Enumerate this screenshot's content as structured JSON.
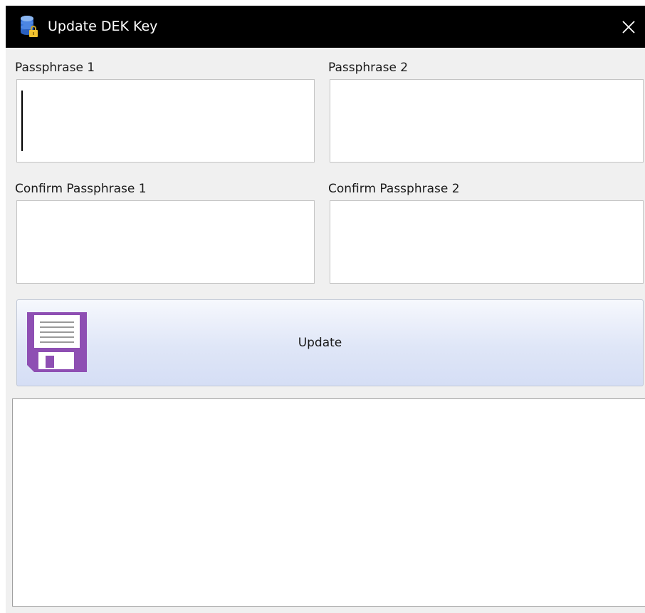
{
  "window": {
    "title": "Update DEK Key",
    "app_icon": "database-lock-icon",
    "close_icon": "close-icon"
  },
  "form": {
    "passphrase_1": {
      "label": "Passphrase 1",
      "value": ""
    },
    "passphrase_2": {
      "label": "Passphrase 2",
      "value": ""
    },
    "confirm_passphrase_1": {
      "label": "Confirm Passphrase 1",
      "value": ""
    },
    "confirm_passphrase_2": {
      "label": "Confirm Passphrase 2",
      "value": ""
    }
  },
  "update_button": {
    "label": "Update",
    "icon": "floppy-disk-icon"
  },
  "log": {
    "value": ""
  },
  "colors": {
    "titlebar": "#000000",
    "window_bg": "#f0f0f0",
    "button_gradient_top": "#f6f8fd",
    "button_gradient_bottom": "#d5def5",
    "save_icon_purple": "#8e4fb3"
  }
}
